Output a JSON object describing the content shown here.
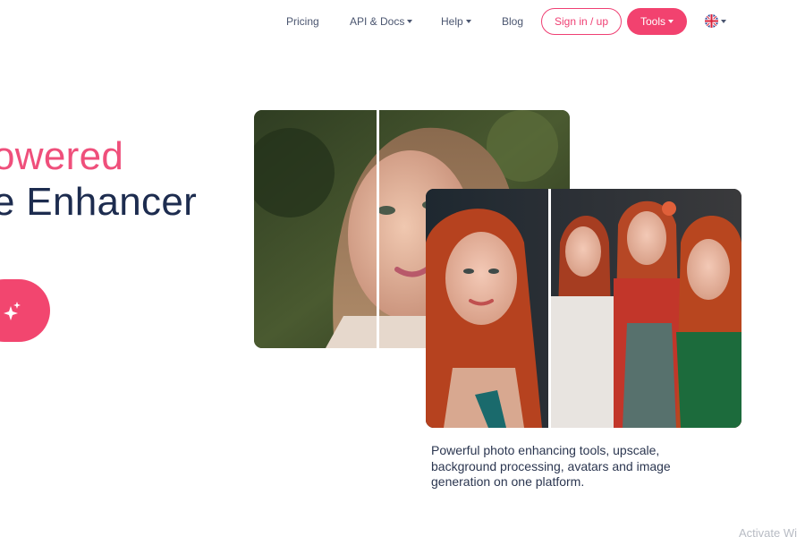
{
  "nav": {
    "pricing": "Pricing",
    "api_docs": "API & Docs",
    "help": "Help",
    "blog": "Blog",
    "sign_in": "Sign in / up",
    "tools": "Tools",
    "language_icon": "uk-flag-icon"
  },
  "hero": {
    "line1": "owered",
    "line2": "e Enhancer",
    "cta_icon": "sparkles-icon"
  },
  "images": {
    "back": "before-after-portrait-blonde",
    "front": "before-after-redhead-avatars"
  },
  "caption": "Powerful photo enhancing tools, upscale, background processing, avatars and image generation on one platform.",
  "watermark": "Activate Wi",
  "colors": {
    "accent": "#f2426f",
    "heading_dark": "#1d2c4f",
    "heading_pink": "#ef4f7b"
  }
}
